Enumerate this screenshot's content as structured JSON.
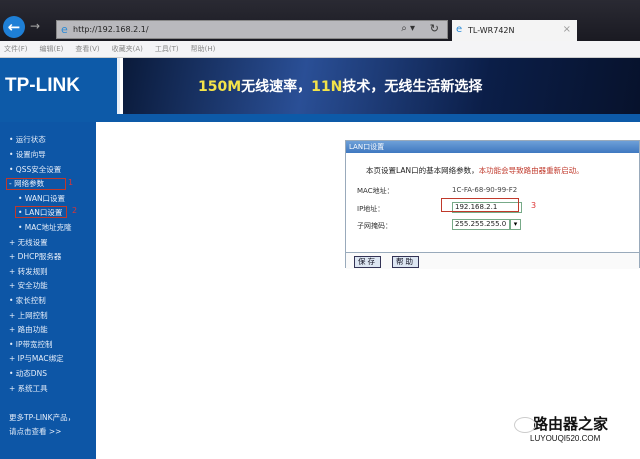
{
  "browser": {
    "url": "http://192.168.2.1/",
    "tab_title": "TL-WR742N",
    "menu": [
      "文件(F)",
      "编辑(E)",
      "查看(V)",
      "收藏夹(A)",
      "工具(T)",
      "帮助(H)"
    ]
  },
  "header": {
    "logo": "TP-LINK",
    "slogan_a": "150M",
    "slogan_b": "无线速率，",
    "slogan_c": "11N",
    "slogan_d": "技术，无线生活新选择"
  },
  "sidebar": {
    "items": [
      {
        "label": "• 运行状态"
      },
      {
        "label": "• 设置向导"
      },
      {
        "label": "• QSS安全设置"
      },
      {
        "label": "- 网络参数"
      },
      {
        "label": "• WAN口设置",
        "sub": true
      },
      {
        "label": "• LAN口设置",
        "sub": true
      },
      {
        "label": "• MAC地址克隆",
        "sub": true
      },
      {
        "label": "+ 无线设置"
      },
      {
        "label": "+ DHCP服务器"
      },
      {
        "label": "+ 转发规则"
      },
      {
        "label": "+ 安全功能"
      },
      {
        "label": "• 家长控制"
      },
      {
        "label": "+ 上网控制"
      },
      {
        "label": "+ 路由功能"
      },
      {
        "label": "• IP带宽控制"
      },
      {
        "label": "+ IP与MAC绑定"
      },
      {
        "label": "• 动态DNS"
      },
      {
        "label": "+ 系统工具"
      }
    ],
    "footer_1": "更多TP-LINK产品，",
    "footer_2": "请点击查看 >>"
  },
  "annotations": {
    "n1": "1",
    "n2": "2",
    "n3": "3"
  },
  "panel": {
    "title": "LAN口设置",
    "desc": "本页设置LAN口的基本网络参数，",
    "warning": "本功能会导致路由器重新启动。",
    "mac_label": "MAC地址：",
    "mac_value": "1C-FA-68-90-99-F2",
    "ip_label": "IP地址：",
    "ip_value": "192.168.2.1",
    "mask_label": "子网掩码：",
    "mask_value": "255.255.255.0",
    "save": "保存",
    "help": "帮助"
  },
  "watermark": {
    "cn": "路由器之家",
    "en": "LUYOUQI520.COM"
  }
}
